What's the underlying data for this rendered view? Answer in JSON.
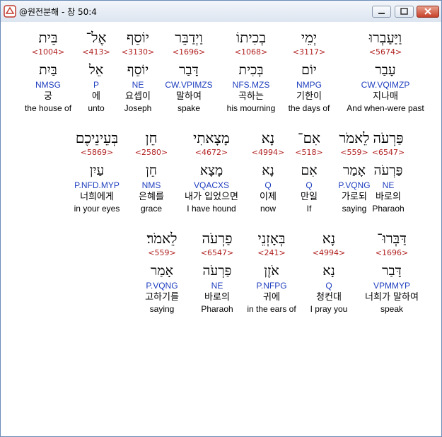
{
  "window": {
    "title": "@원전분해 - 창 50:4"
  },
  "colors": {
    "strong": "#b22222",
    "morph": "#1f3fbf"
  },
  "rows": [
    [
      {
        "heb": "וַיַּעַבְרוּ",
        "num": "<5674>",
        "lemma": "עָבַר",
        "morph": "CW.VQIMZP",
        "kor": "지나매",
        "eng": "And when-were past"
      },
      {
        "heb": "יְמֵי",
        "num": "<3117>",
        "lemma": "יוֹם",
        "morph": "NMPG",
        "kor": "기한이",
        "eng": "the days of"
      },
      {
        "heb": "בְכִיתוֹ",
        "num": "<1068>",
        "lemma": "בְּכִית",
        "morph": "NFS.MZS",
        "kor": "곡하는",
        "eng": "his mourning"
      },
      {
        "heb": "וַיְדַבֵּר",
        "num": "<1696>",
        "lemma": "דָּבַר",
        "morph": "CW.VPIMZS",
        "kor": "말하여",
        "eng": "spake"
      },
      {
        "heb": "יוֹסֵף",
        "num": "<3130>",
        "lemma": "יוֹסֵף",
        "morph": "NE",
        "kor": "요셉이",
        "eng": "Joseph"
      },
      {
        "heb": "אֶל־",
        "num": "<413>",
        "lemma": "אֵל",
        "morph": "P",
        "kor": "에",
        "eng": "unto"
      },
      {
        "heb": "בֵּית",
        "num": "<1004>",
        "lemma": "בַּיִת",
        "morph": "NMSG",
        "kor": "궁",
        "eng": "the house of"
      }
    ],
    [
      {
        "heb": "פַּרְעֹה",
        "num": "<6547>",
        "lemma": "פַּרְעֹה",
        "morph": "NE",
        "kor": "바로의",
        "eng": "Pharaoh"
      },
      {
        "heb": "לֵאמֹר",
        "num": "<559>",
        "lemma": "אָמַר",
        "morph": "P.VQNG",
        "kor": "가로되",
        "eng": "saying"
      },
      {
        "heb": "אִם־",
        "num": "<518>",
        "lemma": "אִם",
        "morph": "Q",
        "kor": "만일",
        "eng": "If"
      },
      {
        "heb": "נָא",
        "num": "<4994>",
        "lemma": "נָא",
        "morph": "Q",
        "kor": "이제",
        "eng": "now"
      },
      {
        "heb": "מָצָאתִי",
        "num": "<4672>",
        "lemma": "מָצָא",
        "morph": "VQACXS",
        "kor": "내가 입었으면",
        "eng": "I have hound"
      },
      {
        "heb": "חֵן",
        "num": "<2580>",
        "lemma": "חֵן",
        "morph": "NMS",
        "kor": "은혜를",
        "eng": "grace"
      },
      {
        "heb": "בְּעֵינֵיכֶם",
        "num": "<5869>",
        "lemma": "עַיִן",
        "morph": "P.NFD.MYP",
        "kor": "너희에게",
        "eng": "in your eyes"
      }
    ],
    [
      {
        "heb": "דַּבְּרוּ־",
        "num": "<1696>",
        "lemma": "דָּבַר",
        "morph": "VPMMYP",
        "kor": "너희가 말하여",
        "eng": "speak"
      },
      {
        "heb": "נָא",
        "num": "<4994>",
        "lemma": "נָא",
        "morph": "Q",
        "kor": "청컨대",
        "eng": "I pray you"
      },
      {
        "heb": "בְּאָזְנֵי",
        "num": "<241>",
        "lemma": "אֹזֶן",
        "morph": "P.NFPG",
        "kor": "귀에",
        "eng": "in the ears of"
      },
      {
        "heb": "פַרְעֹה",
        "num": "<6547>",
        "lemma": "פַּרְעֹה",
        "morph": "NE",
        "kor": "바로의",
        "eng": "Pharaoh"
      },
      {
        "heb": "לֵאמֹר׃",
        "num": "<559>",
        "lemma": "אָמַר",
        "morph": "P.VQNG",
        "kor": "고하기를",
        "eng": "saying"
      }
    ]
  ]
}
